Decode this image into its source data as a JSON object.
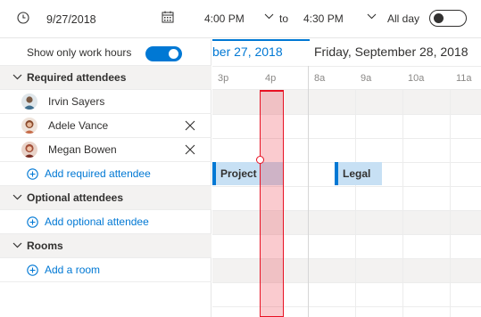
{
  "topbar": {
    "date": "9/27/2018",
    "start_time": "4:00 PM",
    "to_label": "to",
    "end_time": "4:30 PM",
    "allday_label": "All day",
    "allday_on": false
  },
  "left": {
    "work_hours_label": "Show only work hours",
    "work_hours_on": true,
    "required_header": "Required attendees",
    "attendees": [
      {
        "name": "Irvin Sayers",
        "removable": false
      },
      {
        "name": "Adele Vance",
        "removable": true
      },
      {
        "name": "Megan Bowen",
        "removable": true
      }
    ],
    "add_required": "Add required attendee",
    "optional_header": "Optional attendees",
    "add_optional": "Add optional attendee",
    "rooms_header": "Rooms",
    "add_room": "Add a room"
  },
  "grid": {
    "day1_label": "ber 27, 2018",
    "day2_label": "Friday, September 28, 2018",
    "hours": [
      "3p",
      "4p",
      "8a",
      "9a",
      "10a",
      "11a"
    ],
    "events": [
      {
        "label": "Project",
        "attendee": "Megan Bowen",
        "day": 1
      },
      {
        "label": "Legal",
        "attendee": "Megan Bowen",
        "day": 2
      }
    ]
  },
  "colors": {
    "accent": "#0078d4",
    "selection": "#e81123",
    "event_fill": "#c7e0f4"
  }
}
